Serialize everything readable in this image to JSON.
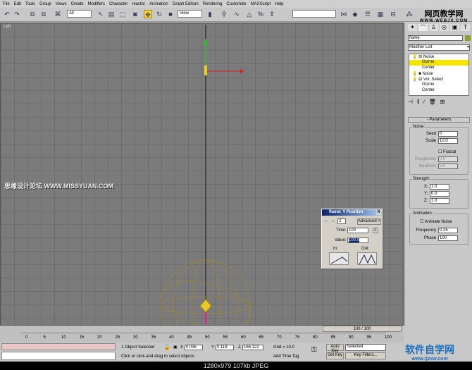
{
  "menu": [
    "File",
    "Edit",
    "Tools",
    "Group",
    "Views",
    "Create",
    "Modifiers",
    "Character",
    "reactor",
    "Animation",
    "Graph Editors",
    "Rendering",
    "Customize",
    "MAXScript",
    "Help"
  ],
  "toolbar": {
    "selection_filter": "All",
    "ref_coord": "View"
  },
  "viewport": {
    "label": "Left",
    "watermark": "思缘设计论坛 WWW.MISSYUAN.COM"
  },
  "watermark_top": {
    "cn": "网页教学网",
    "url": "WWW.WEBJX.COM"
  },
  "watermark_bottom": {
    "cn": "软件自学网",
    "url": "www.rjzxw.com"
  },
  "command_panel": {
    "object_name": "flame",
    "modifier_list": "Modifier List",
    "stack": [
      "Noise",
      "Gizmo",
      "Center",
      "Noise",
      "Vol. Select",
      "Gizmo",
      "Center"
    ],
    "rollout": "Parameters",
    "noise": {
      "title": "Noise:",
      "seed_label": "Seed",
      "seed": "0",
      "scale_label": "Scale",
      "scale": "10.0",
      "fractal": "Fractal",
      "roughness_label": "Roughness",
      "roughness": "0.0",
      "iterations_label": "Iterations",
      "iterations": "6.0"
    },
    "strength": {
      "title": "Strength:",
      "x_label": "X:",
      "x": "1.0",
      "y_label": "Y:",
      "y": "0.0",
      "z_label": "Z:",
      "z": "1.0"
    },
    "animation": {
      "title": "Animation:",
      "animate_noise": "Animate Noise",
      "frequency_label": "Frequency",
      "frequency": "0.25",
      "phase_label": "Phase",
      "phase": "100"
    }
  },
  "dialog": {
    "title": "flame: Y Position",
    "key": "2",
    "advanced": "Advanced >",
    "time_label": "Time:",
    "time": "100",
    "lock": "L",
    "value_label": "Value:",
    "value": "100.0",
    "in": "In:",
    "out": "Out:",
    "close": "X"
  },
  "timeline": {
    "frame": "100 / 100",
    "ticks": [
      "0",
      "5",
      "10",
      "15",
      "20",
      "25",
      "30",
      "35",
      "40",
      "45",
      "50",
      "55",
      "60",
      "65",
      "70",
      "75",
      "80",
      "85",
      "90",
      "95",
      "100"
    ]
  },
  "status": {
    "selected": "1 Object Selected",
    "prompt": "Click or click-and-drag to select objects",
    "x_label": "X",
    "x": "0.035",
    "y_label": "Y",
    "y": "0.119",
    "z_label": "Z",
    "z": "166.121",
    "grid": "Grid = 10.0",
    "add_time_tag": "Add Time Tag",
    "auto_key": "Auto Key",
    "set_key": "Set Key",
    "key_mode": "Selected",
    "key_filters": "Key Filters..."
  },
  "caption": "1280x979  107kb  JPEG"
}
